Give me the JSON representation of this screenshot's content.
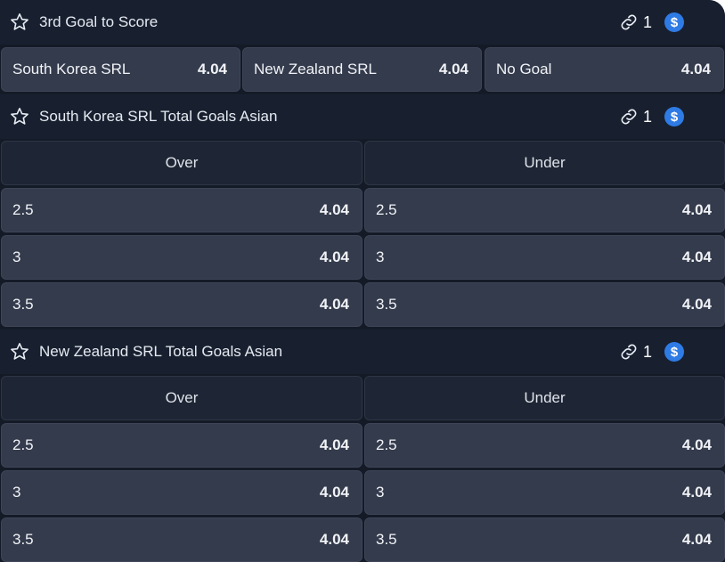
{
  "markets": [
    {
      "title": "3rd Goal to Score",
      "link_count": "1",
      "coin_symbol": "$",
      "outcomes": [
        {
          "label": "South Korea SRL",
          "odds": "4.04"
        },
        {
          "label": "New Zealand SRL",
          "odds": "4.04"
        },
        {
          "label": "No Goal",
          "odds": "4.04"
        }
      ]
    },
    {
      "title": "South Korea SRL Total Goals Asian",
      "link_count": "1",
      "coin_symbol": "$",
      "columns": [
        "Over",
        "Under"
      ],
      "rows": [
        {
          "over": {
            "line": "2.5",
            "odds": "4.04"
          },
          "under": {
            "line": "2.5",
            "odds": "4.04"
          }
        },
        {
          "over": {
            "line": "3",
            "odds": "4.04"
          },
          "under": {
            "line": "3",
            "odds": "4.04"
          }
        },
        {
          "over": {
            "line": "3.5",
            "odds": "4.04"
          },
          "under": {
            "line": "3.5",
            "odds": "4.04"
          }
        }
      ]
    },
    {
      "title": "New Zealand SRL Total Goals Asian",
      "link_count": "1",
      "coin_symbol": "$",
      "columns": [
        "Over",
        "Under"
      ],
      "rows": [
        {
          "over": {
            "line": "2.5",
            "odds": "4.04"
          },
          "under": {
            "line": "2.5",
            "odds": "4.04"
          }
        },
        {
          "over": {
            "line": "3",
            "odds": "4.04"
          },
          "under": {
            "line": "3",
            "odds": "4.04"
          }
        },
        {
          "over": {
            "line": "3.5",
            "odds": "4.04"
          },
          "under": {
            "line": "3.5",
            "odds": "4.04"
          }
        }
      ]
    }
  ],
  "icons": {
    "favorite": "star-outline-icon",
    "link": "link-icon",
    "coin": "dollar-coin-icon"
  },
  "colors": {
    "background": "#141b27",
    "header": "#182030",
    "cell": "#343b4c",
    "column_header": "#1e2534",
    "coin": "#2f7be5"
  }
}
